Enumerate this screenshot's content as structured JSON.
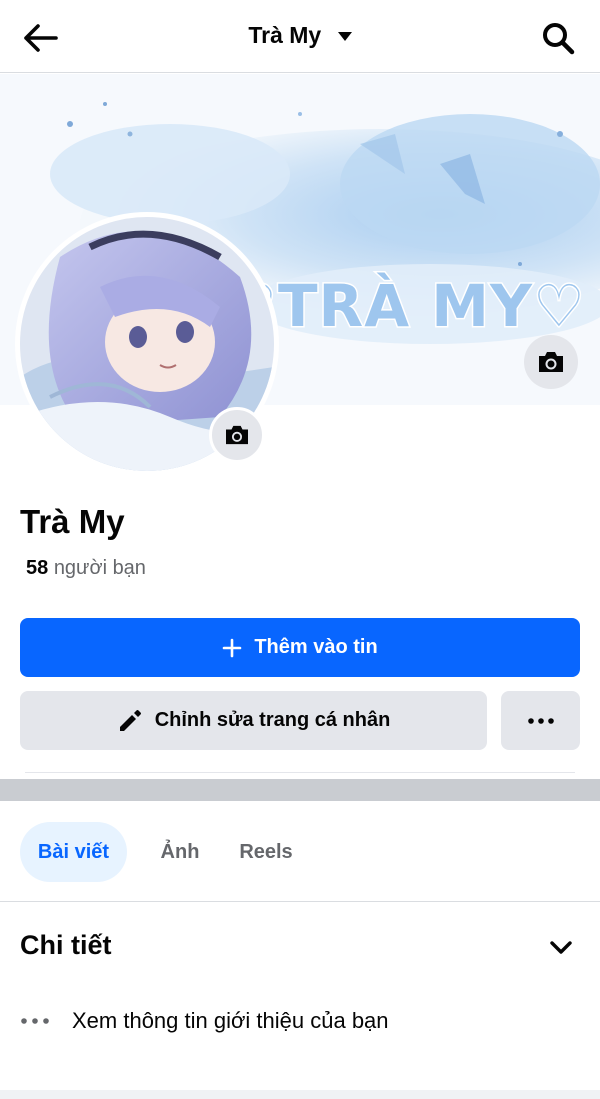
{
  "header": {
    "title": "Trà My",
    "back_icon": "arrow-left-icon",
    "dropdown_icon": "caret-down-icon",
    "search_icon": "search-icon"
  },
  "cover": {
    "banner_text": "♡TRÀ MY♡",
    "camera_icon": "camera-icon"
  },
  "profile": {
    "name": "Trà My",
    "friends_count": "58",
    "friends_label": "người bạn"
  },
  "actions": {
    "add_story_label": "Thêm vào tin",
    "add_story_icon": "plus-icon",
    "edit_profile_label": "Chỉnh sửa trang cá nhân",
    "edit_icon": "pencil-icon",
    "more_icon": "more-horizontal-icon"
  },
  "tabs": [
    {
      "label": "Bài viết",
      "active": true
    },
    {
      "label": "Ảnh",
      "active": false
    },
    {
      "label": "Reels",
      "active": false
    }
  ],
  "details": {
    "title": "Chi tiết",
    "intro_text": "Xem thông tin giới thiệu của bạn"
  },
  "colors": {
    "accent": "#0866ff",
    "button_gray": "#e4e6eb",
    "tab_active_bg": "#e7f3ff"
  }
}
